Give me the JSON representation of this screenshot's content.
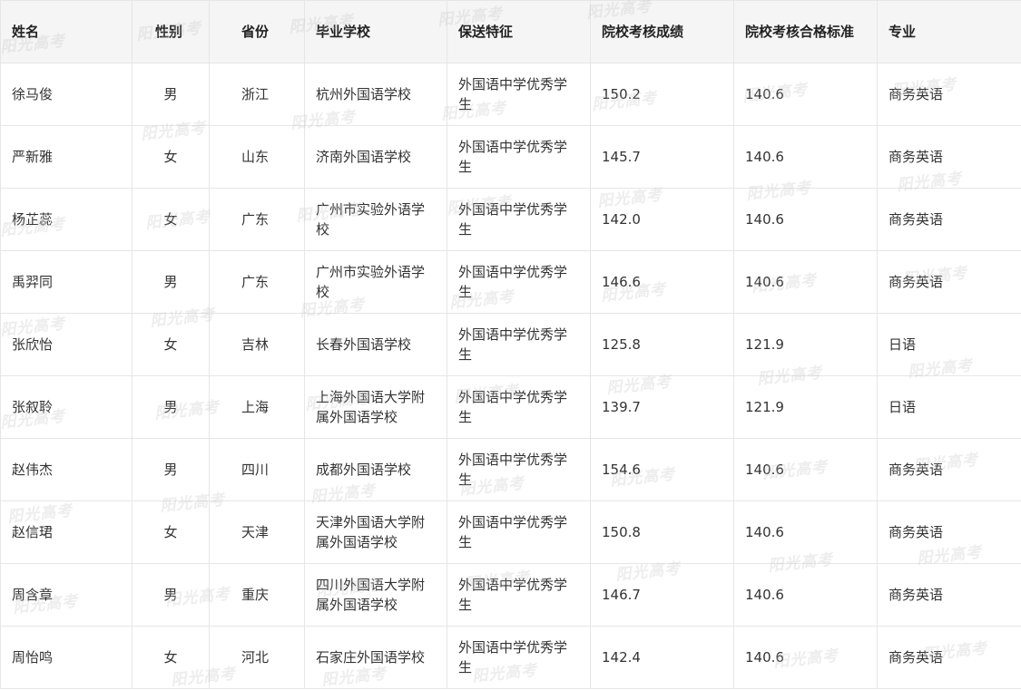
{
  "table": {
    "headers": [
      "姓名",
      "性别",
      "省份",
      "毕业学校",
      "保送特征",
      "院校考核成绩",
      "院校考核合格标准",
      "专业"
    ],
    "rows": [
      [
        "徐马俊",
        "男",
        "浙江",
        "杭州外国语学校",
        "外国语中学优秀学生",
        "150.2",
        "140.6",
        "商务英语"
      ],
      [
        "严新雅",
        "女",
        "山东",
        "济南外国语学校",
        "外国语中学优秀学生",
        "145.7",
        "140.6",
        "商务英语"
      ],
      [
        "杨芷蕊",
        "女",
        "广东",
        "广州市实验外语学校",
        "外国语中学优秀学生",
        "142.0",
        "140.6",
        "商务英语"
      ],
      [
        "禹羿同",
        "男",
        "广东",
        "广州市实验外语学校",
        "外国语中学优秀学生",
        "146.6",
        "140.6",
        "商务英语"
      ],
      [
        "张欣怡",
        "女",
        "吉林",
        "长春外国语学校",
        "外国语中学优秀学生",
        "125.8",
        "121.9",
        "日语"
      ],
      [
        "张叙聆",
        "男",
        "上海",
        "上海外国语大学附属外国语学校",
        "外国语中学优秀学生",
        "139.7",
        "121.9",
        "日语"
      ],
      [
        "赵伟杰",
        "男",
        "四川",
        "成都外国语学校",
        "外国语中学优秀学生",
        "154.6",
        "140.6",
        "商务英语"
      ],
      [
        "赵信珺",
        "女",
        "天津",
        "天津外国语大学附属外国语学校",
        "外国语中学优秀学生",
        "150.8",
        "140.6",
        "商务英语"
      ],
      [
        "周含章",
        "男",
        "重庆",
        "四川外国语大学附属外国语学校",
        "外国语中学优秀学生",
        "146.7",
        "140.6",
        "商务英语"
      ],
      [
        "周怡鸣",
        "女",
        "河北",
        "石家庄外国语学校",
        "外国语中学优秀学生",
        "142.4",
        "140.6",
        "商务英语"
      ]
    ]
  },
  "watermark": {
    "text": "阳光高考"
  }
}
